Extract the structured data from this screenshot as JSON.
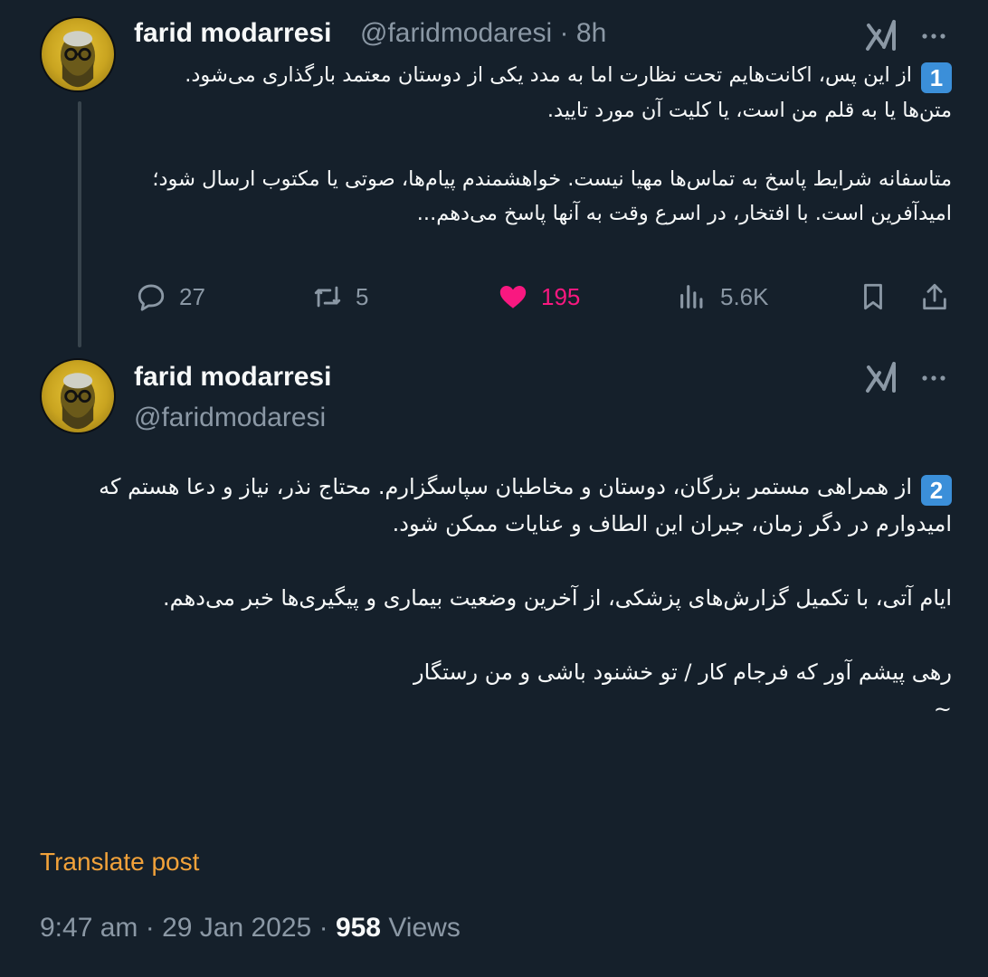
{
  "tweet1": {
    "author_name": "farid modarresi",
    "handle": "@faridmodaresi",
    "separator": "·",
    "time": "8h",
    "badge": "1",
    "text": "از این پس، اکانت‌هایم تحت نظارت اما به مدد یکی از دوستان معتمد بارگذاری می‌شود. متن‌ها یا به قلم من است، یا کلیت آن مورد تایید.\n\nمتاسفانه شرایط پاسخ به تماس‌ها مهیا نیست. خواهشمندم پیام‌ها، صوتی یا مکتوب ارسال شود؛ امیدآفرین است. با افتخار، در اسرع وقت به آنها پاسخ می‌دهم...",
    "replies": "27",
    "reposts": "5",
    "likes": "195",
    "views": "5.6K"
  },
  "tweet2": {
    "author_name": "farid modarresi",
    "handle": "@faridmodaresi",
    "badge": "2",
    "text": "از همراهی مستمر بزرگان، دوستان و مخاطبان سپاسگزارم. محتاج نذر، نیاز و دعا هستم که امیدوارم در دگر زمان، جبران این الطاف و عنایات ممکن شود.\n\nایام آتی، با تکمیل گزارش‌های پزشکی، از آخرین وضعیت بیماری و پیگیری‌ها خبر می‌دهم.\n\nرهی پیشم آور که فرجام کار / تو خشنود باشی و من رستگار\n~",
    "translate_label": "Translate post",
    "time": "9:47 am",
    "date": "29 Jan 2025",
    "views_count": "958",
    "views_label": "Views",
    "separator": "·"
  },
  "colors": {
    "background": "#15202b",
    "text": "#f7f9f9",
    "muted": "#8b98a5",
    "like": "#f91880",
    "translate": "#f2a23a",
    "badge": "#3b8fd9"
  },
  "icons": [
    "avatar",
    "grok-icon",
    "more-icon",
    "reply-icon",
    "repost-icon",
    "like-icon",
    "views-icon",
    "bookmark-icon",
    "share-icon"
  ]
}
